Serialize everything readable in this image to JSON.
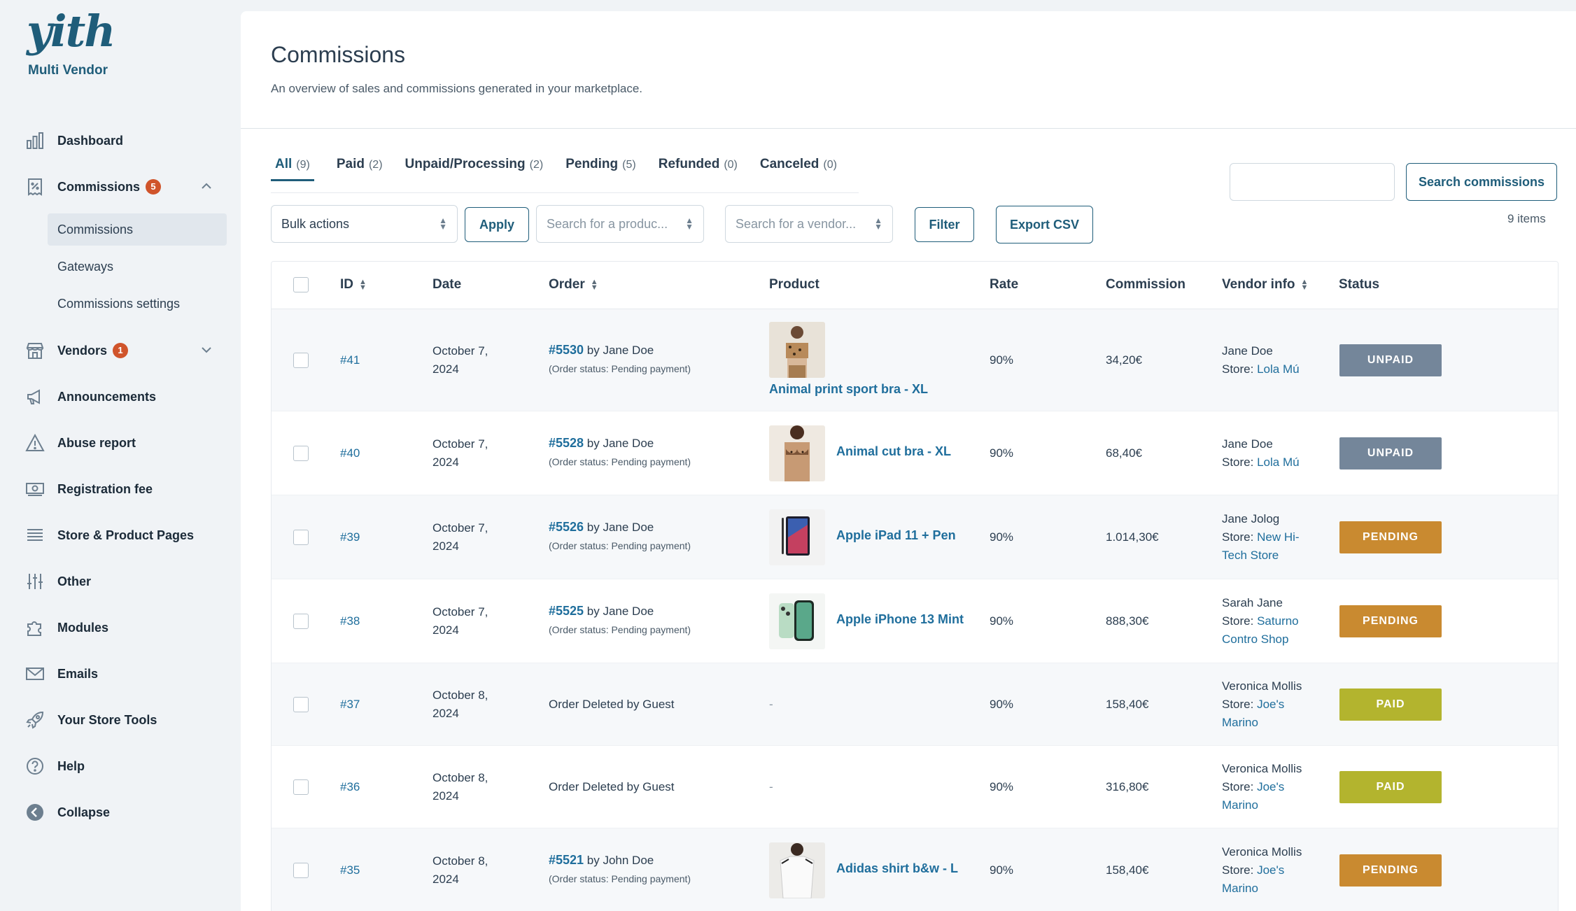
{
  "brand": {
    "logo": "yith",
    "subtitle": "Multi Vendor"
  },
  "sidebar": {
    "items": [
      {
        "label": "Dashboard",
        "icon": "bar-chart-icon"
      },
      {
        "label": "Commissions",
        "icon": "receipt-icon",
        "badge": "5"
      },
      {
        "label": "Vendors",
        "icon": "store-icon",
        "badge": "1"
      },
      {
        "label": "Announcements",
        "icon": "megaphone-icon"
      },
      {
        "label": "Abuse report",
        "icon": "warning-icon"
      },
      {
        "label": "Registration fee",
        "icon": "money-icon"
      },
      {
        "label": "Store & Product Pages",
        "icon": "list-icon"
      },
      {
        "label": "Other",
        "icon": "sliders-icon"
      },
      {
        "label": "Modules",
        "icon": "puzzle-icon"
      },
      {
        "label": "Emails",
        "icon": "mail-icon"
      },
      {
        "label": "Your Store Tools",
        "icon": "rocket-icon"
      },
      {
        "label": "Help",
        "icon": "help-icon"
      },
      {
        "label": "Collapse",
        "icon": "collapse-icon"
      }
    ],
    "sub_items": [
      "Commissions",
      "Gateways",
      "Commissions settings"
    ]
  },
  "page": {
    "title": "Commissions",
    "subtitle": "An overview of sales and commissions generated in your marketplace."
  },
  "tabs": [
    {
      "label": "All",
      "count": "(9)"
    },
    {
      "label": "Paid",
      "count": "(2)"
    },
    {
      "label": "Unpaid/Processing",
      "count": "(2)"
    },
    {
      "label": "Pending",
      "count": "(5)"
    },
    {
      "label": "Refunded",
      "count": "(0)"
    },
    {
      "label": "Canceled",
      "count": "(0)"
    }
  ],
  "toolbar": {
    "search_button": "Search commissions",
    "items_count": "9 items",
    "bulk_actions": "Bulk actions",
    "apply": "Apply",
    "product_placeholder": "Search for a produc...",
    "vendor_placeholder": "Search for a vendor...",
    "filter": "Filter",
    "export": "Export CSV"
  },
  "table": {
    "headers": {
      "id": "ID",
      "date": "Date",
      "order": "Order",
      "product": "Product",
      "rate": "Rate",
      "commission": "Commission",
      "vendor": "Vendor info",
      "status": "Status"
    },
    "rows": [
      {
        "id": "#41",
        "date1": "October 7,",
        "date2": "2024",
        "order_link": "#5530",
        "order_by": " by Jane Doe",
        "order_status": "(Order status: Pending payment)",
        "product": "Animal print sport bra - XL",
        "rate": "90%",
        "commission": "34,20€",
        "vendor_name": "Jane Doe",
        "store_prefix": "Store: ",
        "store_line1": "Lola Mú",
        "store_line2": "",
        "status": "UNPAID",
        "status_color": "#74869a"
      },
      {
        "id": "#40",
        "date1": "October 7,",
        "date2": "2024",
        "order_link": "#5528",
        "order_by": " by Jane Doe",
        "order_status": "(Order status: Pending payment)",
        "product": "Animal cut bra - XL",
        "rate": "90%",
        "commission": "68,40€",
        "vendor_name": "Jane Doe",
        "store_prefix": "Store: ",
        "store_line1": "Lola Mú",
        "store_line2": "",
        "status": "UNPAID",
        "status_color": "#74869a"
      },
      {
        "id": "#39",
        "date1": "October 7,",
        "date2": "2024",
        "order_link": "#5526",
        "order_by": " by Jane Doe",
        "order_status": "(Order status: Pending payment)",
        "product": "Apple iPad 11 + Pen",
        "rate": "90%",
        "commission": "1.014,30€",
        "vendor_name": "Jane Jolog",
        "store_prefix": "Store: ",
        "store_line1": "New Hi-",
        "store_line2": "Tech Store",
        "status": "PENDING",
        "status_color": "#c98a30"
      },
      {
        "id": "#38",
        "date1": "October 7,",
        "date2": "2024",
        "order_link": "#5525",
        "order_by": " by Jane Doe",
        "order_status": "(Order status: Pending payment)",
        "product": "Apple iPhone 13 Mint",
        "rate": "90%",
        "commission": "888,30€",
        "vendor_name": "Sarah Jane",
        "store_prefix": "Store: ",
        "store_line1": "Saturno",
        "store_line2": "Contro Shop",
        "status": "PENDING",
        "status_color": "#c98a30"
      },
      {
        "id": "#37",
        "date1": "October 8,",
        "date2": "2024",
        "order_text": "Order Deleted by Guest",
        "product": "-",
        "rate": "90%",
        "commission": "158,40€",
        "vendor_name": "Veronica Mollis",
        "store_prefix": "Store: ",
        "store_line1": "Joe's",
        "store_line2": "Marino",
        "status": "PAID",
        "status_color": "#b3b42e"
      },
      {
        "id": "#36",
        "date1": "October 8,",
        "date2": "2024",
        "order_text": "Order Deleted by Guest",
        "product": "-",
        "rate": "90%",
        "commission": "316,80€",
        "vendor_name": "Veronica Mollis",
        "store_prefix": "Store: ",
        "store_line1": "Joe's",
        "store_line2": "Marino",
        "status": "PAID",
        "status_color": "#b3b42e"
      },
      {
        "id": "#35",
        "date1": "October 8,",
        "date2": "2024",
        "order_link": "#5521",
        "order_by": " by John Doe",
        "order_status": "(Order status: Pending payment)",
        "product": "Adidas shirt b&w - L",
        "rate": "90%",
        "commission": "158,40€",
        "vendor_name": "Veronica Mollis",
        "store_prefix": "Store: ",
        "store_line1": "Joe's",
        "store_line2": "Marino",
        "status": "PENDING",
        "status_color": "#c98a30"
      }
    ]
  }
}
